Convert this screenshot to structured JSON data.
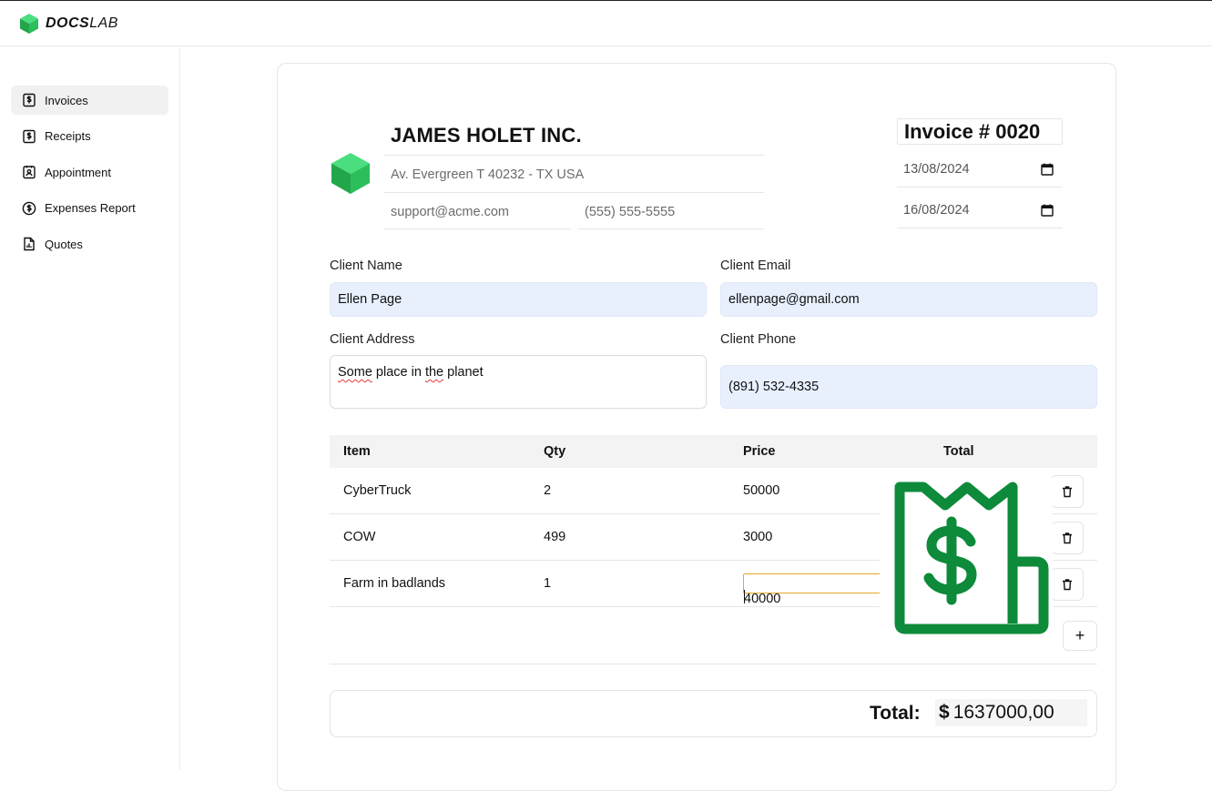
{
  "app": {
    "brand_bold": "DOCS",
    "brand_light": "LAB"
  },
  "sidebar": {
    "items": [
      {
        "label": "Invoices",
        "icon": "invoice-dollar-icon",
        "active": true
      },
      {
        "label": "Receipts",
        "icon": "receipt-dollar-icon",
        "active": false
      },
      {
        "label": "Appointment",
        "icon": "contact-card-icon",
        "active": false
      },
      {
        "label": "Expenses Report",
        "icon": "dollar-circle-icon",
        "active": false
      },
      {
        "label": "Quotes",
        "icon": "document-chart-icon",
        "active": false
      }
    ]
  },
  "invoice": {
    "company_name": "JAMES HOLET INC.",
    "company_address": "Av. Evergreen T 40232 - TX USA",
    "company_email": "support@acme.com",
    "company_phone": "(555) 555-5555",
    "number_prefix": "Invoice #",
    "number": "0020",
    "issue_date": "13/08/2024",
    "due_date": "16/08/2024"
  },
  "client": {
    "name_label": "Client Name",
    "name": "Ellen Page",
    "email_label": "Client Email",
    "email": "ellenpage@gmail.com",
    "address_label": "Client Address",
    "address_word1": "Some",
    "address_mid": " place in ",
    "address_word2": "the",
    "address_end": " planet",
    "phone_label": "Client Phone",
    "phone": "(891) 532-4335"
  },
  "table": {
    "headers": {
      "item": "Item",
      "qty": "Qty",
      "price": "Price",
      "total": "Total"
    },
    "rows": [
      {
        "item": "CyberTruck",
        "qty": "2",
        "price": "50000"
      },
      {
        "item": "COW",
        "qty": "499",
        "price": "3000"
      },
      {
        "item": "Farm in badlands",
        "qty": "1",
        "price": "40000"
      }
    ],
    "add_label": "+"
  },
  "totals": {
    "label": "Total:",
    "currency": "$",
    "value": "1637000,00"
  },
  "colors": {
    "brand_green": "#2dbe5c",
    "receipt_green": "#0d8a3a",
    "input_bg": "#e8f0fe",
    "focus_border": "#e3a82b"
  }
}
